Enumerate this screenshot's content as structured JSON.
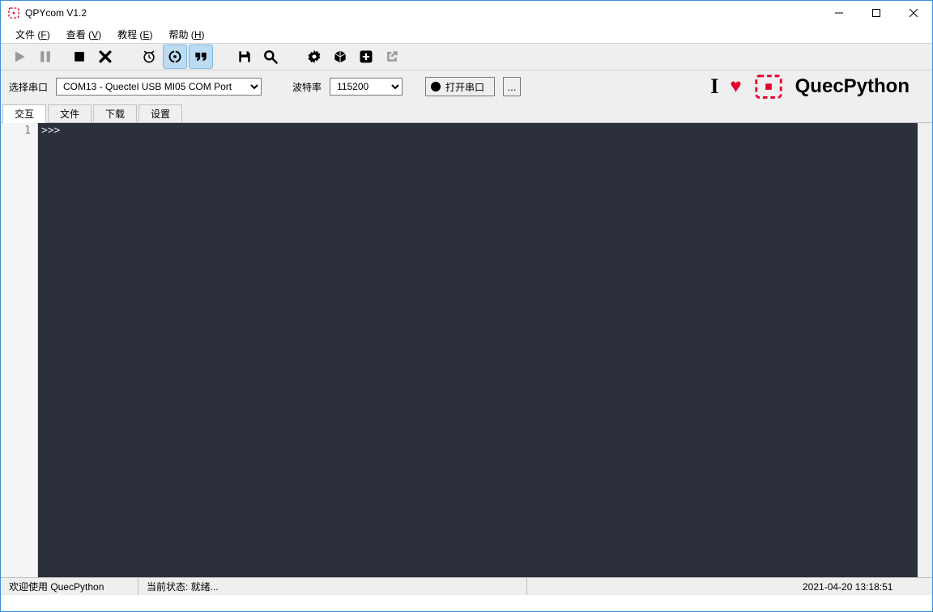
{
  "window": {
    "title": "QPYcom V1.2"
  },
  "menu": {
    "file": "文件",
    "file_hk": "F",
    "view": "查看",
    "view_hk": "V",
    "tutorial": "教程",
    "tutorial_hk": "E",
    "help": "帮助",
    "help_hk": "H"
  },
  "toolbar_icons": {
    "play": "play-icon",
    "pause": "pause-icon",
    "stop": "stop-icon",
    "close": "close-icon",
    "clock": "clock-icon",
    "globe": "globe-icon",
    "quote": "quote-icon",
    "save": "save-icon",
    "search": "search-icon",
    "settings": "gear-icon",
    "cube": "cube-icon",
    "plus": "plus-square-icon",
    "external": "external-link-icon"
  },
  "conn": {
    "port_label": "选择串口",
    "port_value": "COM13 - Quectel USB MI05 COM Port",
    "baud_label": "波特率",
    "baud_value": "115200",
    "open_label": "打开串口",
    "more": "..."
  },
  "logo": {
    "i": "I",
    "text": "QuecPython"
  },
  "tabs": [
    "交互",
    "文件",
    "下载",
    "设置"
  ],
  "active_tab": 0,
  "editor": {
    "gutter": "1",
    "content": ">>>"
  },
  "status": {
    "welcome": "欢迎使用 QuecPython",
    "state": "当前状态: 就绪...",
    "timestamp": "2021-04-20 13:18:51"
  }
}
